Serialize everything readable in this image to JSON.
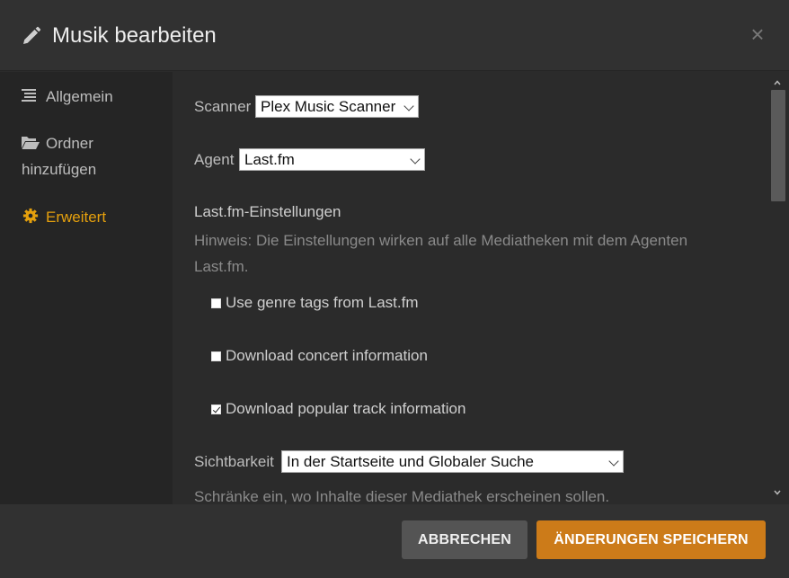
{
  "dialog": {
    "title": "Musik bearbeiten",
    "close_symbol": "×"
  },
  "sidebar": {
    "items": [
      {
        "label": "Allgemein",
        "icon": "list-icon",
        "active": false
      },
      {
        "label_line1": "Ordner",
        "label_line2": "hinzufügen",
        "icon": "folder-open-icon",
        "active": false
      },
      {
        "label": "Erweitert",
        "icon": "gear-icon",
        "active": true
      }
    ]
  },
  "form": {
    "scanner": {
      "label": "Scanner",
      "value": "Plex Music Scanner"
    },
    "agent": {
      "label": "Agent",
      "value": "Last.fm"
    },
    "lastfm_section": {
      "title": "Last.fm-Einstellungen",
      "hint": "Hinweis: Die Einstellungen wirken auf alle Mediatheken mit dem Agenten Last.fm."
    },
    "checkboxes": [
      {
        "label": "Use genre tags from Last.fm",
        "checked": false
      },
      {
        "label": "Download concert information",
        "checked": false
      },
      {
        "label": "Download popular track information",
        "checked": true
      }
    ],
    "visibility": {
      "label": "Sichtbarkeit",
      "value": "In der Startseite und Globaler Suche",
      "description": "Schränke ein, wo Inhalte dieser Mediathek erscheinen sollen."
    }
  },
  "footer": {
    "cancel_label": "ABBRECHEN",
    "save_label": "ÄNDERUNGEN SPEICHERN"
  },
  "colors": {
    "accent": "#e5a00d",
    "save_button": "#cc7b19",
    "cancel_button": "#545454"
  }
}
